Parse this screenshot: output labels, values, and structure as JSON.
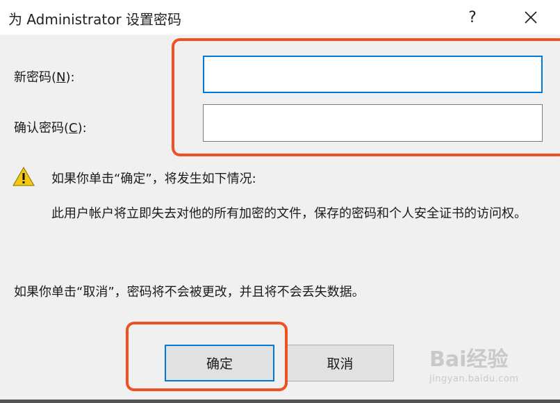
{
  "window": {
    "title": "为 Administrator 设置密码",
    "help_label": "?"
  },
  "fields": {
    "new_password_label": "新密码(",
    "new_password_accel": "N",
    "new_password_suffix": "):",
    "new_password_value": "",
    "confirm_password_label": "确认密码(",
    "confirm_password_accel": "C",
    "confirm_password_suffix": "):",
    "confirm_password_value": ""
  },
  "warning": {
    "icon": "warning-icon",
    "headline": "如果你单击“确定”，将发生如下情况:",
    "detail": "此用户帐户将立即失去对他的所有加密的文件，保存的密码和个人安全证书的访问权。"
  },
  "cancel_note": "如果你单击“取消”，密码将不会被更改，并且将不会丢失数据。",
  "buttons": {
    "ok_label": "确定",
    "cancel_label": "取消"
  },
  "watermark": {
    "logo": "Bai经验",
    "url": "jingyan.baidu.com"
  },
  "colors": {
    "accent": "#0078d7",
    "highlight": "#f05023",
    "warning": "#f2c811"
  }
}
